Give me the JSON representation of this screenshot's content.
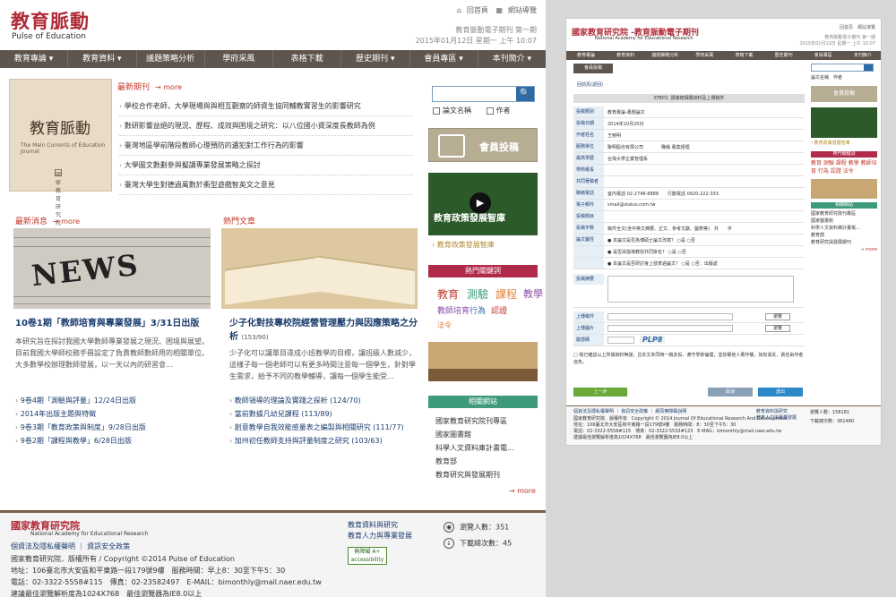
{
  "main": {
    "logo": {
      "title": "教育脈動",
      "subtitle": "Pulse of Education"
    },
    "toplinks": [
      "回首頁",
      "網站導覽"
    ],
    "issue": {
      "line1": "教育脈動電子期刊 第一期",
      "line2": "2015年01月12日 星期一 上午 10:07"
    },
    "nav": [
      "教育專論 ▾",
      "教育資料 ▾",
      "議題策略分析",
      "學府采風",
      "表格下載",
      "歷史期刊 ▾",
      "會員專區 ▾",
      "本刊簡介 ▾"
    ],
    "cover": {
      "title": "教育脈動",
      "subtitle": "The Main Currents of Education Journal",
      "publisher": "國家教育研究院"
    },
    "latest": {
      "heading": "最新期刊",
      "more": "→ more",
      "items": [
        "學校合作老師，大學現場與與相互觀察的師資生協同輔教實習生的影響研究",
        "數研影響益絕的現況、歷程、成效與困境之研究：以八位國小資深度長教師為例",
        "臺灣地區學前階段教師心理預防的遺犯對工作行為的影響",
        "大學圖文數劃參與擬讀專業發展策略之探討",
        "臺灣大學生對德過萬數於衝型遊戲智英文之意見"
      ]
    },
    "news": {
      "heading": "最新消息",
      "more": "→ more",
      "image_word": "NEWS",
      "title": "10卷1期「教師培育與專業發展」3/31日出版",
      "desc": "本研究旨在探討我國大學數師專業發展之現況、困境與展望。目前我國大學師校務手冊設定了負責教師數師用的相關單位。大多數學校辦理數師發展，以一天以內的研習會...",
      "items": [
        "9卷4期「測驗與評量」12/24日出版",
        "2014年出版主題與特徵",
        "9卷3期「教育政策與制度」9/28日出版",
        "9卷2期「課程與教學」6/28日出版"
      ]
    },
    "hot": {
      "heading": "熱門文章",
      "title": "少子化對技專校院經營管理壓力與因應策略之分析",
      "title_count": "(153/90)",
      "desc": "少子化可以讓單目違成小班教學的目標，讓班級人數減少，這樣子每一個老師可以有更多時間注意每一個學生，針對學生需求，給予不同的教學輔導，讓每一個學生能受...",
      "items": [
        "教師領導的理論及實踐之探析 (124/70)",
        "當前數據凡幼兒課程 (113/89)",
        "創意教學自我效能感量表之編製與相關研究 (111/77)",
        "加州初任教師支持與評量制度之研究 (103/63)"
      ]
    },
    "sidebar": {
      "search_placeholder": "",
      "search_button": "🔍",
      "opt_title": "論文名稱",
      "opt_author": "作者",
      "member_submit": "會員投稿",
      "video_label": "教育政策發展智庫",
      "video_caption": "› 教育政策發展智庫",
      "hot_keywords_heading": "熱門關鍵詞",
      "tags": [
        "教育",
        "測驗",
        "課程",
        "教學",
        "教師培育",
        "行為",
        "認證",
        "法令"
      ],
      "related_heading": "相關網站",
      "related": [
        "國家教育研究院刊專區",
        "國家圖書館",
        "科學人文資料庫計畫電...",
        "教育部",
        "教育研究與發展期刊"
      ],
      "more": "→ more"
    },
    "footer": {
      "logo": "國家教育研究院",
      "logo_sub": "National Academy for Educational Research",
      "links": "個資法及隱私權聲明 ｜ 資訊安全政策",
      "lines": [
        "國家教育研究院．版權所有 / Copyright ©2014 Pulse of Education",
        "地址：106臺北市大安區和平東路一段179號9樓　服務時間：早上8：30至下午5：30",
        "電話：02-3322-5558#115　傳真：02-23582497　E-MAIL：bimonthly@mail.naer.edu.tw",
        "建議最佳瀏覽解析度為1024X768　最佳瀏覽器為IE8.0以上"
      ],
      "mid_links": [
        "教育資料與研究",
        "教育人力與專業發展"
      ],
      "accessibility": "無障礙 A+ accessibility",
      "visitors": "瀏覽人數：351",
      "downloads": "下載總次數：45"
    }
  },
  "preview": {
    "logo": "國家教育研究院 -教育脈動電子期刊",
    "logo_sub": "National Academy for Educational Research",
    "toplinks": "回首頁　網站導覽",
    "issue": [
      "教育脈動電子期刊 第一期",
      "2015年01月12日 星期一 上午 10:07"
    ],
    "nav": [
      "教育專論",
      "教育資料",
      "議題策略分析",
      "學府采風",
      "表格下載",
      "歷史期刊",
      "會員專區",
      "本刊簡介"
    ],
    "tab": "會員投稿",
    "back": "回前頁(返回)",
    "step": "STEP2: 請填寫相關資料及上傳稿件",
    "fields": [
      {
        "label": "投稿類別",
        "value": "教育專論-專題論文"
      },
      {
        "label": "投稿日期",
        "value": "2014年10月20日"
      },
      {
        "label": "作者姓名",
        "value": "王曉明"
      },
      {
        "label": "服務單位",
        "value": "聯明股份有限公司　　　　職稱 專案經理"
      },
      {
        "label": "最高學歷",
        "value": "台灣大學企業管理系"
      },
      {
        "label": "學術專長",
        "value": ""
      },
      {
        "label": "共同著稿者",
        "value": ""
      },
      {
        "label": "聯絡電話",
        "value": "室內電話 02-2748-8888　　行動電話 0920-222-333"
      },
      {
        "label": "電子郵件",
        "value": "smail@status.com.tw"
      },
      {
        "label": "投稿題目",
        "value": ""
      },
      {
        "label": "投稿字數",
        "value": "稿件全文(含中英文摘要、正文、參考文獻、圖表等)　共　　字"
      },
      {
        "label": "論文屬性",
        "value": "● 本論文是否為博碩士論文改寫？ ○是 ○否"
      },
      {
        "label": "",
        "value": "● 是否與指導教授共同掛名？ ○是 ○否"
      },
      {
        "label": "",
        "value": "● 本論文是否研討會上發表過論文？ ○是 ○否：出版處"
      }
    ],
    "abstract_label": "投稿摘要",
    "upload_rows": [
      "上傳稿件",
      "上傳圖片",
      "驗證碼"
    ],
    "browse": "瀏覽",
    "captcha": "PLP8",
    "agree": "□ 我已確認以上所填資料無誤，且本文未同時一稿多投，遵守學術倫理，並授權他人著作權，如有違反，責任由作者自負。",
    "btn_prev": "上一步",
    "btn_cancel": "取消",
    "btn_submit": "送出",
    "side": {
      "opt_title": "論文名稱",
      "opt_author": "作者",
      "submit": "會員投稿",
      "video_caption": "› 教育政策發展智庫",
      "hot": "熱門關鍵詞",
      "tags": "教育 測驗 課程 教學 教師培育 行為 認證 法令",
      "related": "相關網站",
      "related_items": [
        "國家教育研究院刊專區",
        "國家圖書館",
        "科學人文資料庫計畫電...",
        "教育部",
        "教育研究與發展期刊"
      ],
      "more": "→ more"
    },
    "footer": {
      "links": "個資法及隱私權聲明 ｜ 資訊安全政策 ｜ 網頁無障礙說明",
      "lines": [
        "國家教育研究院．版權所有　Copyright © 2014 Journal Of Educational Research And Development",
        "地址：106臺北市大安區和平東路一段179號9樓　服務時間：8：30至下午5：30",
        "電話：02-3322-5558#115　傳真：02-3322-5533#123　E-MAIL：bimonthly@mail.naer.edu.tw",
        "建議最佳瀏覽解析度為1024X768　最佳瀏覽器為IE8.0以上"
      ],
      "mid": [
        "教育資料與研究",
        "教育人力與專業發展"
      ],
      "visitors": "瀏覽人數：158181",
      "downloads": "下載總次數：381480"
    }
  },
  "colors": {
    "brand": "#b02a37",
    "nav": "#5e554e",
    "link": "#1a3c6e",
    "keywords_bar": "#b02a4a",
    "related_bar": "#3d9a7a"
  }
}
